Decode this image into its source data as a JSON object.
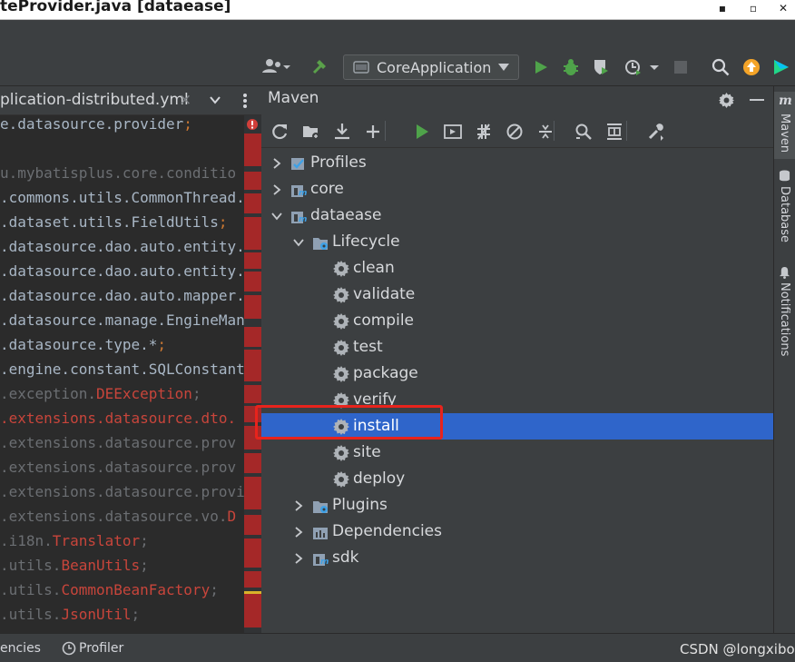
{
  "window": {
    "title": "teProvider.java [dataease]",
    "minimize_glyph": "▪",
    "maximize_glyph": "▫",
    "close_glyph": "✕"
  },
  "toolbar": {
    "run_config": "CoreApplication",
    "icons": [
      "user-icon",
      "build-hammer-icon",
      "run-icon",
      "debug-icon",
      "coverage-icon",
      "profile-icon",
      "stop-icon",
      "search-icon",
      "update-icon",
      "toolbox-icon"
    ]
  },
  "editor": {
    "tab_label": "plication-distributed.yml",
    "tab_close": "×",
    "lines": [
      {
        "segments": [
          {
            "t": "e.datasource.provider",
            "c": "#a9b7c6"
          },
          {
            "t": ";",
            "c": "#cc7832"
          }
        ]
      },
      {
        "segments": [
          {
            "t": "",
            "c": "#a9b7c6"
          }
        ]
      },
      {
        "segments": [
          {
            "t": "u.mybatisplus.core.conditio",
            "c": "#6b6e72"
          }
        ]
      },
      {
        "segments": [
          {
            "t": ".commons.utils.CommonThread.",
            "c": "#a9b7c6"
          }
        ]
      },
      {
        "segments": [
          {
            "t": ".dataset.utils.FieldUtils",
            "c": "#a9b7c6"
          },
          {
            "t": ";",
            "c": "#cc7832"
          }
        ]
      },
      {
        "segments": [
          {
            "t": ".datasource.dao.auto.entity.",
            "c": "#a9b7c6"
          }
        ]
      },
      {
        "segments": [
          {
            "t": ".datasource.dao.auto.entity.",
            "c": "#a9b7c6"
          }
        ]
      },
      {
        "segments": [
          {
            "t": ".datasource.dao.auto.mapper.",
            "c": "#a9b7c6"
          }
        ]
      },
      {
        "segments": [
          {
            "t": ".datasource.manage.EngineMana",
            "c": "#a9b7c6"
          }
        ]
      },
      {
        "segments": [
          {
            "t": ".datasource.type.*",
            "c": "#a9b7c6"
          },
          {
            "t": ";",
            "c": "#cc7832"
          }
        ]
      },
      {
        "segments": [
          {
            "t": ".engine.constant.SQLConstant",
            "c": "#a9b7c6"
          }
        ]
      },
      {
        "segments": [
          {
            "t": ".exception.",
            "c": "#6b6e72"
          },
          {
            "t": "DEException",
            "c": "#c8453b"
          },
          {
            "t": ";",
            "c": "#6b6e72"
          }
        ]
      },
      {
        "segments": [
          {
            "t": ".extensions.datasource.dto.",
            "c": "#c8453b"
          }
        ]
      },
      {
        "segments": [
          {
            "t": ".extensions.datasource.prov",
            "c": "#6b6e72"
          }
        ]
      },
      {
        "segments": [
          {
            "t": ".extensions.datasource.prov",
            "c": "#6b6e72"
          }
        ]
      },
      {
        "segments": [
          {
            "t": ".extensions.datasource.provi",
            "c": "#6b6e72"
          }
        ]
      },
      {
        "segments": [
          {
            "t": ".extensions.datasource.vo.",
            "c": "#6b6e72"
          },
          {
            "t": "D",
            "c": "#c8453b"
          }
        ]
      },
      {
        "segments": [
          {
            "t": ".i18n.",
            "c": "#6b6e72"
          },
          {
            "t": "Translator",
            "c": "#c8453b"
          },
          {
            "t": ";",
            "c": "#6b6e72"
          }
        ]
      },
      {
        "segments": [
          {
            "t": ".utils.",
            "c": "#6b6e72"
          },
          {
            "t": "BeanUtils",
            "c": "#c8453b"
          },
          {
            "t": ";",
            "c": "#6b6e72"
          }
        ]
      },
      {
        "segments": [
          {
            "t": ".utils.",
            "c": "#6b6e72"
          },
          {
            "t": "CommonBeanFactory",
            "c": "#c8453b"
          },
          {
            "t": ";",
            "c": "#6b6e72"
          }
        ]
      },
      {
        "segments": [
          {
            "t": ".utils.",
            "c": "#6b6e72"
          },
          {
            "t": "JsonUtil",
            "c": "#c8453b"
          },
          {
            "t": ";",
            "c": "#6b6e72"
          }
        ]
      }
    ]
  },
  "maven": {
    "title": "Maven",
    "toolbar_icons": [
      "reload-icon",
      "add-folder-icon",
      "download-icon",
      "plus-icon",
      "run-icon",
      "run-config-icon",
      "toggle-offline-icon",
      "skip-tests-icon",
      "collapse-icon",
      "analyze-icon",
      "show-dependencies-icon",
      "settings-wrench-icon"
    ],
    "tree": [
      {
        "label": "Profiles",
        "depth": 0,
        "chevron": "right",
        "icon": "profiles-icon"
      },
      {
        "label": "core",
        "depth": 0,
        "chevron": "right",
        "icon": "maven-module-icon"
      },
      {
        "label": "dataease",
        "depth": 0,
        "chevron": "down",
        "icon": "maven-module-icon"
      },
      {
        "label": "Lifecycle",
        "depth": 1,
        "chevron": "down",
        "icon": "lifecycle-folder-icon"
      },
      {
        "label": "clean",
        "depth": 2,
        "chevron": "none",
        "icon": "gear-icon"
      },
      {
        "label": "validate",
        "depth": 2,
        "chevron": "none",
        "icon": "gear-icon"
      },
      {
        "label": "compile",
        "depth": 2,
        "chevron": "none",
        "icon": "gear-icon"
      },
      {
        "label": "test",
        "depth": 2,
        "chevron": "none",
        "icon": "gear-icon"
      },
      {
        "label": "package",
        "depth": 2,
        "chevron": "none",
        "icon": "gear-icon"
      },
      {
        "label": "verify",
        "depth": 2,
        "chevron": "none",
        "icon": "gear-icon"
      },
      {
        "label": "install",
        "depth": 2,
        "chevron": "none",
        "icon": "gear-icon",
        "selected": true
      },
      {
        "label": "site",
        "depth": 2,
        "chevron": "none",
        "icon": "gear-icon"
      },
      {
        "label": "deploy",
        "depth": 2,
        "chevron": "none",
        "icon": "gear-icon"
      },
      {
        "label": "Plugins",
        "depth": 1,
        "chevron": "right",
        "icon": "plugins-folder-icon"
      },
      {
        "label": "Dependencies",
        "depth": 1,
        "chevron": "right",
        "icon": "dependencies-icon"
      },
      {
        "label": "sdk",
        "depth": 1,
        "chevron": "right",
        "icon": "maven-module-icon"
      }
    ]
  },
  "right_strip": {
    "maven": "Maven",
    "database": "Database",
    "notifications": "Notifications"
  },
  "statusbar": {
    "left_item": "encies",
    "profiler": "Profiler",
    "watermark": "CSDN @longxibo"
  },
  "colors": {
    "selection": "#2f65ca",
    "highlight_box": "#e8231c",
    "run_green": "#4fa34a",
    "error_red": "#a52828"
  }
}
